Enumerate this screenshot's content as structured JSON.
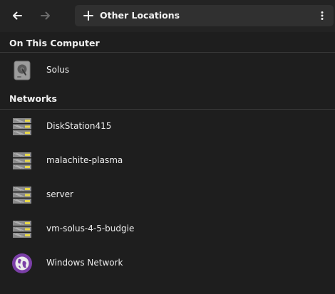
{
  "headerbar": {
    "location_title": "Other Locations",
    "icons": [
      "back-icon",
      "forward-icon",
      "plus-icon",
      "menu-icon"
    ]
  },
  "sections": [
    {
      "title": "On This Computer",
      "items": [
        {
          "label": "Solus",
          "icon": "hard-drive-icon"
        }
      ]
    },
    {
      "title": "Networks",
      "items": [
        {
          "label": "DiskStation415",
          "icon": "network-server-icon"
        },
        {
          "label": "malachite-plasma",
          "icon": "network-server-icon"
        },
        {
          "label": "server",
          "icon": "network-server-icon"
        },
        {
          "label": "vm-solus-4-5-budgie",
          "icon": "network-server-icon"
        },
        {
          "label": "Windows Network",
          "icon": "network-workgroup-icon"
        }
      ]
    }
  ],
  "colors": {
    "background": "#1e1e1e",
    "headerbar": "#232323",
    "pathbar": "#303030",
    "workgroup_accent": "#7b3fa7"
  }
}
